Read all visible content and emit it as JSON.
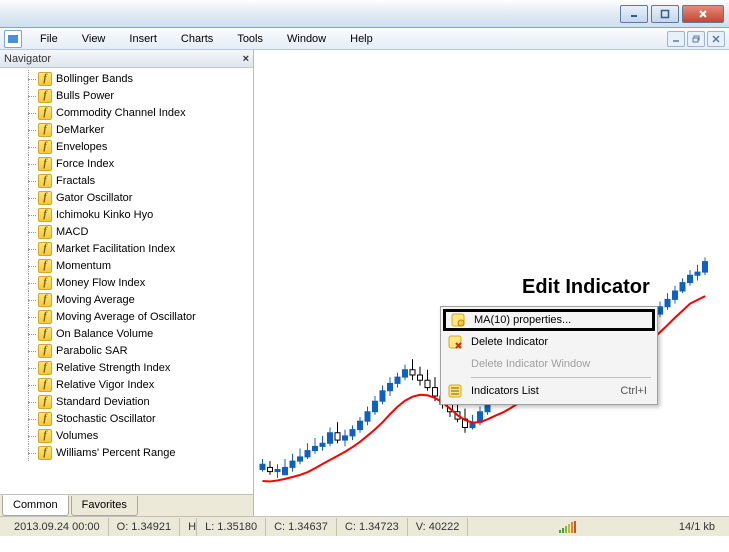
{
  "titlebar": {
    "buttons": [
      "min",
      "max",
      "close"
    ]
  },
  "mdi": {
    "buttons": [
      "min",
      "restore",
      "close"
    ]
  },
  "menu": {
    "items": [
      "File",
      "View",
      "Insert",
      "Charts",
      "Tools",
      "Window",
      "Help"
    ]
  },
  "navigator": {
    "title": "Navigator",
    "tabs": {
      "common": "Common",
      "favorites": "Favorites",
      "active": 0
    },
    "items": [
      "Bollinger Bands",
      "Bulls Power",
      "Commodity Channel Index",
      "DeMarker",
      "Envelopes",
      "Force Index",
      "Fractals",
      "Gator Oscillator",
      "Ichimoku Kinko Hyo",
      "MACD",
      "Market Facilitation Index",
      "Momentum",
      "Money Flow Index",
      "Moving Average",
      "Moving Average of Oscillator",
      "On Balance Volume",
      "Parabolic SAR",
      "Relative Strength Index",
      "Relative Vigor Index",
      "Standard Deviation",
      "Stochastic Oscillator",
      "Volumes",
      "Williams' Percent Range"
    ]
  },
  "context_menu": {
    "properties": "MA(10) properties...",
    "delete": "Delete Indicator",
    "delete_window": "Delete Indicator Window",
    "list": "Indicators List",
    "shortcut": "Ctrl+I"
  },
  "annotation": {
    "label": "Edit Indicator"
  },
  "status": {
    "datetime": "2013.09.24 00:00",
    "open": "O: 1.34921",
    "high": "H",
    "low": "L: 1.35180",
    "close_lbl": "C: 1.34637",
    "close2": "C: 1.34723",
    "volume": "V: 40222",
    "kb": "14/1 kb"
  },
  "chart_data": {
    "type": "candlestick_with_indicator",
    "indicator": "MA(10)",
    "indicator_color": "#ff0000",
    "price_range_approx": [
      1.34,
      1.37
    ],
    "note": "OHLC candlestick chart, ~60 bars, no visible axis labels"
  }
}
